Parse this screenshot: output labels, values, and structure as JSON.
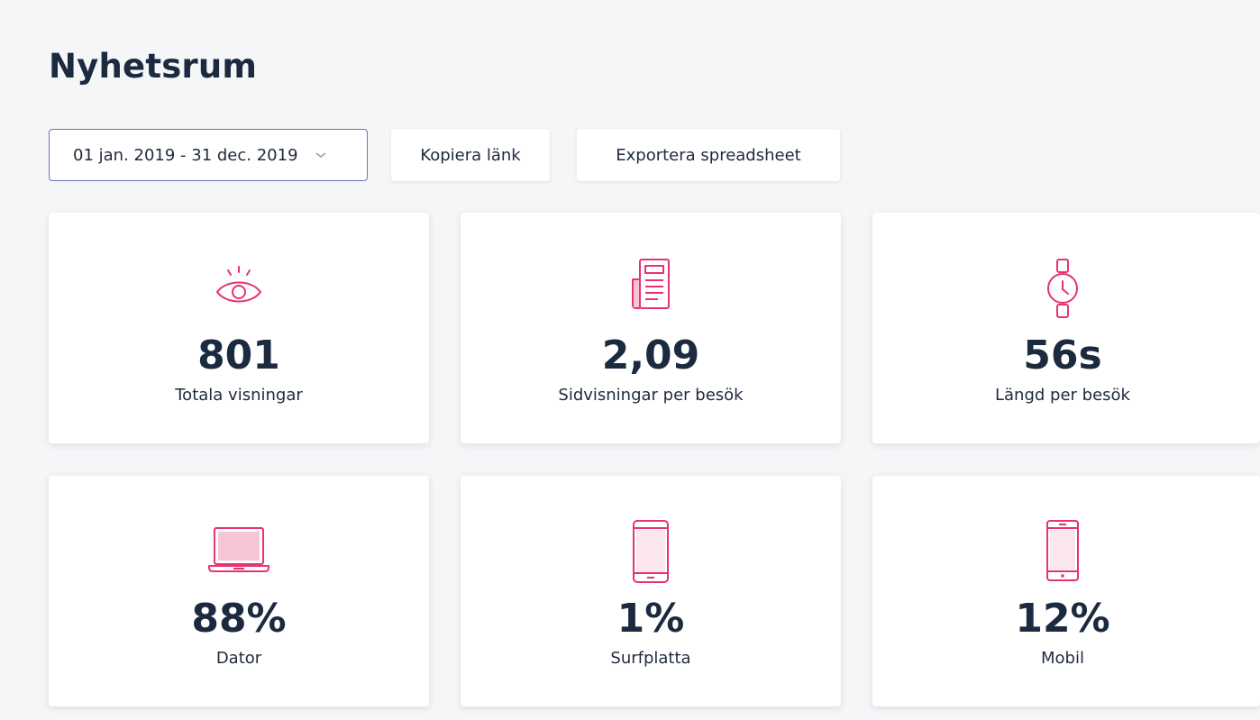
{
  "page": {
    "title": "Nyhetsrum"
  },
  "toolbar": {
    "date_range": "01 jan. 2019 - 31 dec. 2019",
    "copy_link_label": "Kopiera länk",
    "export_label": "Exportera spreadsheet"
  },
  "accent_color": "#e8336f",
  "stats": [
    {
      "icon": "eye-icon",
      "value": "801",
      "label": "Totala visningar"
    },
    {
      "icon": "newspaper-icon",
      "value": "2,09",
      "label": "Sidvisningar per besök"
    },
    {
      "icon": "watch-icon",
      "value": "56s",
      "label": "Längd per besök"
    },
    {
      "icon": "laptop-icon",
      "value": "88%",
      "label": "Dator"
    },
    {
      "icon": "tablet-icon",
      "value": "1%",
      "label": "Surfplatta"
    },
    {
      "icon": "phone-icon",
      "value": "12%",
      "label": "Mobil"
    }
  ]
}
